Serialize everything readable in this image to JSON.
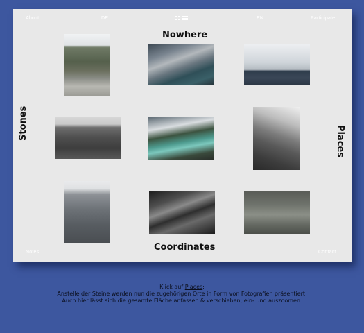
{
  "nav": {
    "about": "About",
    "lang_de": "DE",
    "lang_en": "EN",
    "participate": "Participate",
    "notes": "Notes",
    "contact": "Contact"
  },
  "icons": {
    "grid": "grid-view-icon",
    "list": "list-view-icon"
  },
  "axes": {
    "top": "Nowhere",
    "bottom": "Coordinates",
    "left": "Stones",
    "right": "Places"
  },
  "caption": {
    "line1_prefix": "Klick auf ",
    "line1_link": "Places",
    "line1_suffix": ":",
    "line2": "Anstelle der Steine werden nun die zugehörigen Orte in Form von Fotografien präsentiert.",
    "line3": "Auch hier lässt sich die gesamte Fläche anfassen & verschieben, ein- und auszoomen."
  },
  "colors": {
    "background": "#3d579f",
    "panel": "#e8e8e8"
  }
}
